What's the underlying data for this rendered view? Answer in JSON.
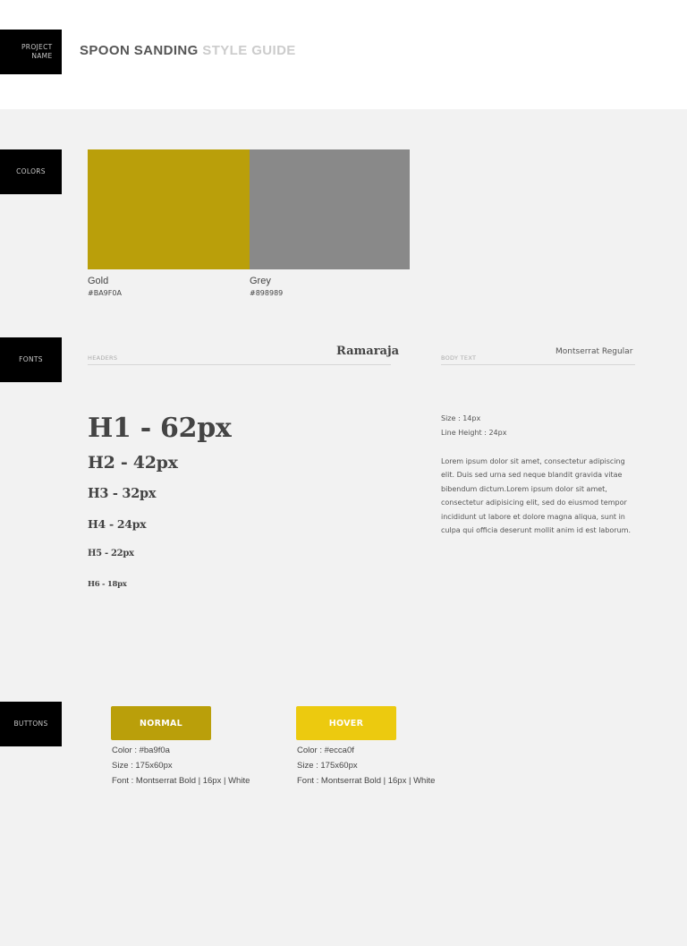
{
  "header": {
    "project_tag": "PROJECT NAME",
    "title_main": "SPOON SANDING",
    "title_sub": "STYLE GUIDE"
  },
  "sections": {
    "colors": "COLORS",
    "fonts": "FONTS",
    "buttons": "BUTTONS"
  },
  "colors": [
    {
      "name": "Gold",
      "hex": "#BA9F0A",
      "swatch": "#BA9F0A"
    },
    {
      "name": "Grey",
      "hex": "#898989",
      "swatch": "#898989"
    }
  ],
  "fonts": {
    "headers_label": "HEADERS",
    "headers_font": "Ramaraja",
    "body_label": "BODY TEXT",
    "body_font": "Montserrat Regular",
    "headings": [
      "H1 - 62px",
      "H2 - 42px",
      "H3 - 32px",
      "H4 - 24px",
      "H5 - 22px",
      "H6 - 18px"
    ],
    "body_size": "Size : 14px",
    "body_line_height": "Line Height : 24px",
    "body_sample": "Lorem ipsum dolor sit amet, consectetur adipiscing elit. Duis sed urna sed neque blandit gravida vitae bibendum dictum.Lorem ipsum dolor sit amet, consectetur adipisicing elit, sed do eiusmod tempor incididunt ut labore et dolore magna aliqua, sunt in culpa qui officia deserunt mollit anim id est laborum."
  },
  "buttons": [
    {
      "label": "NORMAL",
      "bg": "#ba9f0a",
      "color_spec": "Color : #ba9f0a",
      "size_spec": "Size : 175x60px",
      "font_spec": "Font : Montserrat Bold | 16px | White"
    },
    {
      "label": "HOVER",
      "bg": "#ecca0f",
      "color_spec": "Color : #ecca0f",
      "size_spec": "Size : 175x60px",
      "font_spec": "Font : Montserrat Bold | 16px | White"
    }
  ]
}
